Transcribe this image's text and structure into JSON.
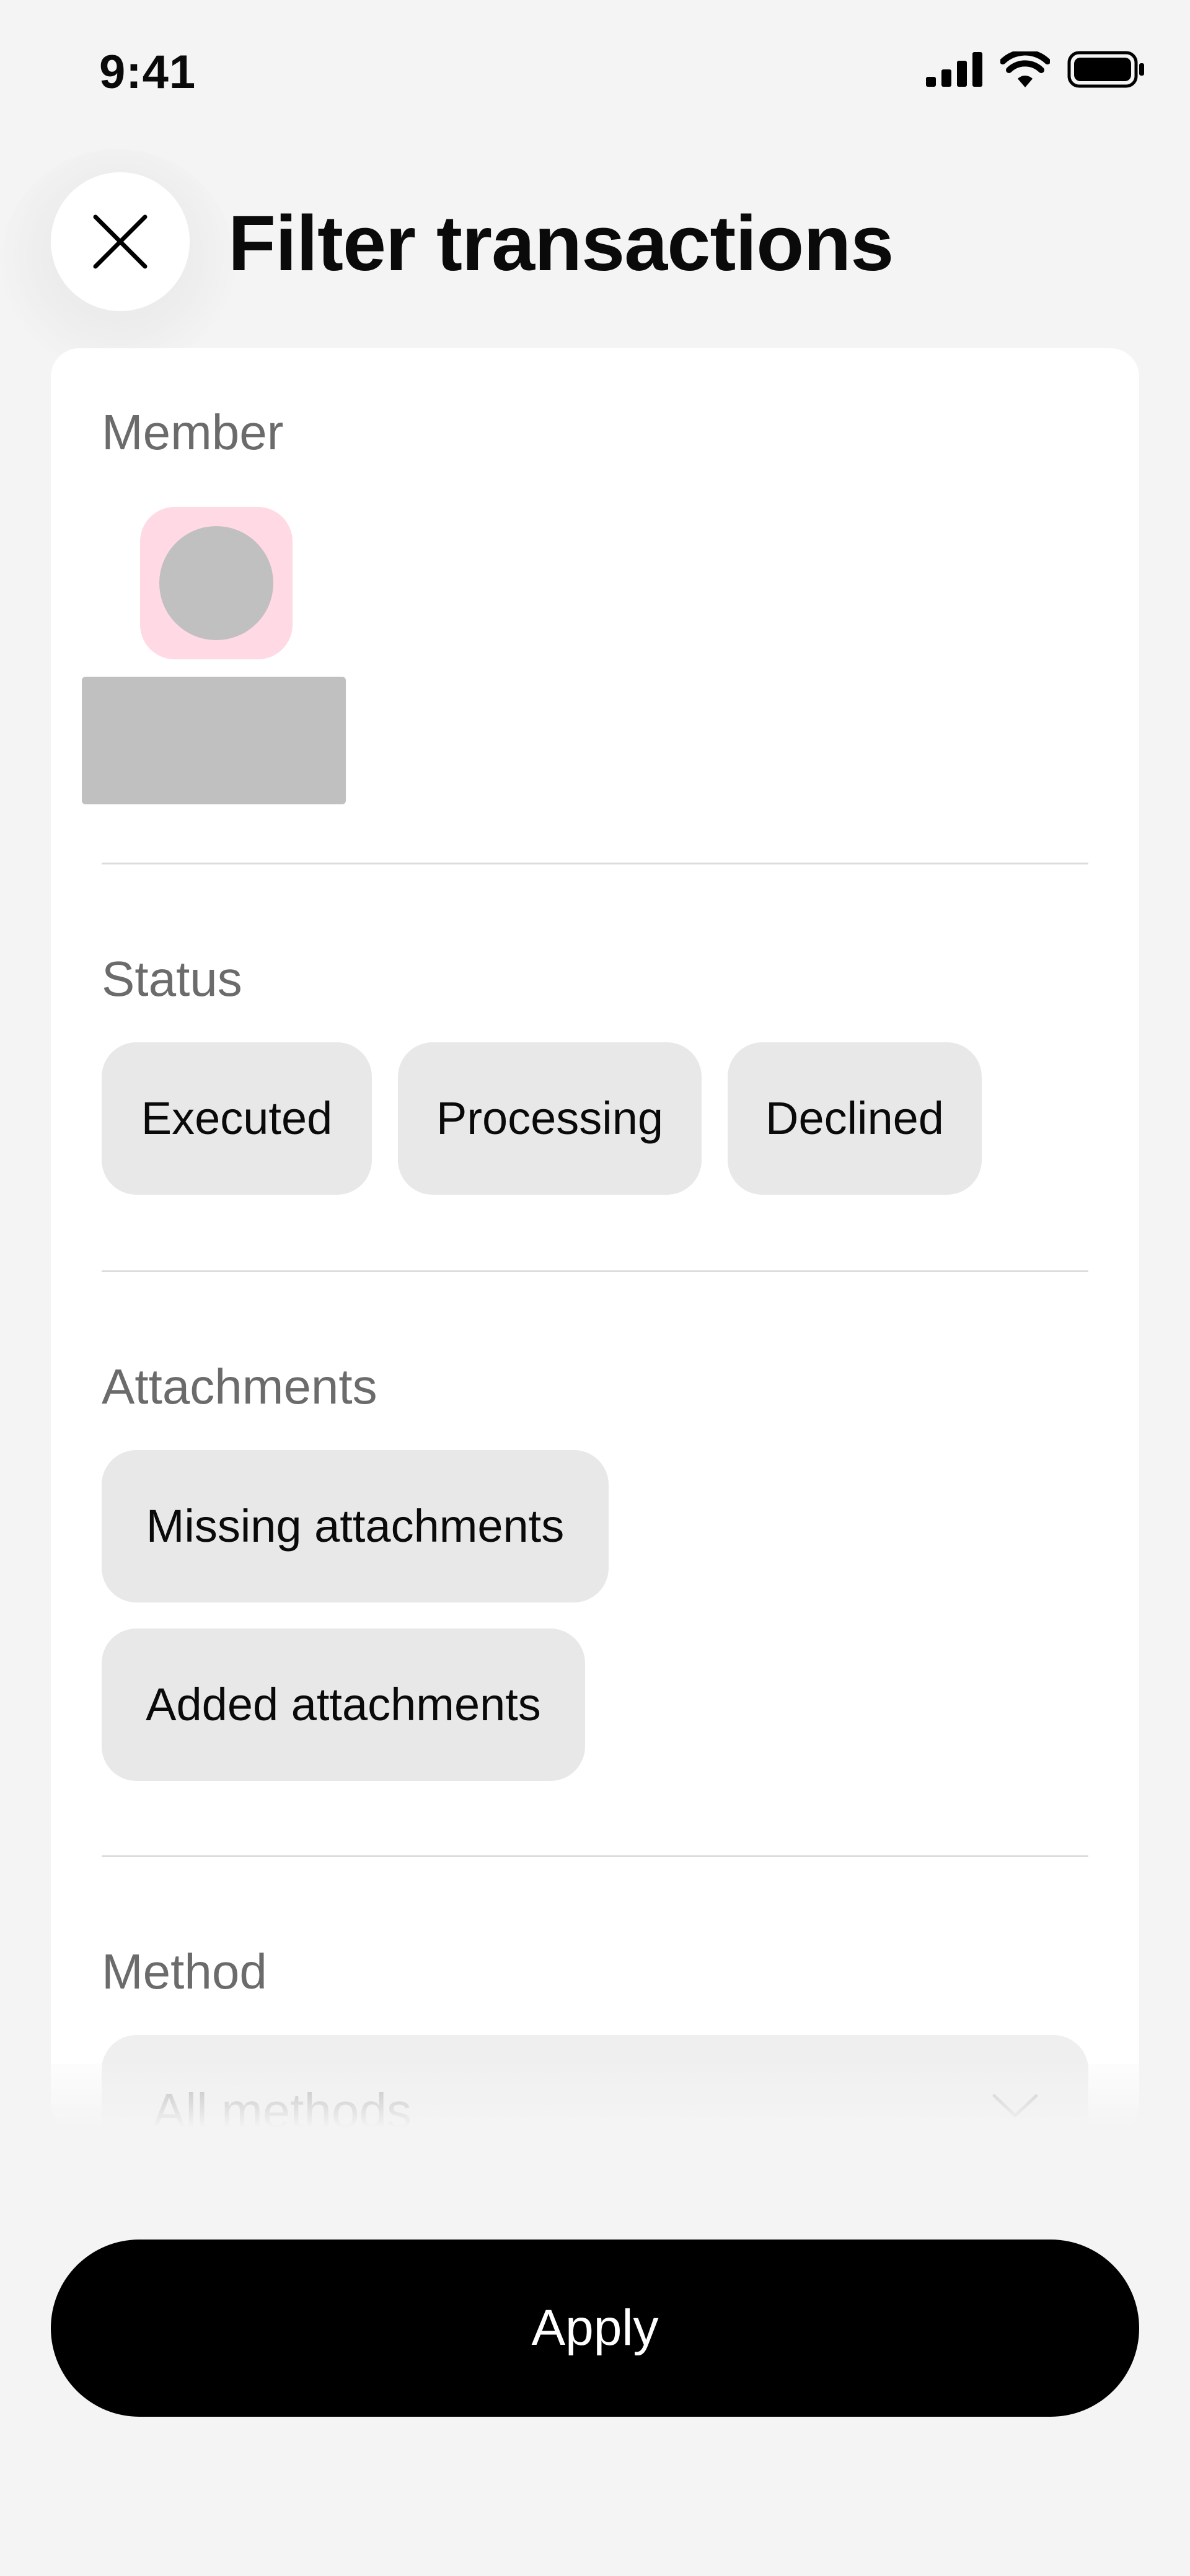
{
  "status_bar": {
    "time": "9:41",
    "icons": [
      "signal-icon",
      "wifi-icon",
      "battery-icon"
    ]
  },
  "header": {
    "close_icon": "close-icon",
    "title": "Filter transactions"
  },
  "sections": {
    "member": {
      "label": "Member"
    },
    "status": {
      "label": "Status",
      "options": [
        "Executed",
        "Processing",
        "Declined"
      ]
    },
    "attachments": {
      "label": "Attachments",
      "options": [
        "Missing attachments",
        "Added attachments"
      ]
    },
    "method": {
      "label": "Method",
      "selected": "All methods",
      "chevron_icon": "chevron-down-icon"
    }
  },
  "footer": {
    "apply_label": "Apply"
  },
  "colors": {
    "background": "#f4f4f4",
    "card": "#ffffff",
    "chip": "#e8e8e8",
    "avatar_bg": "#ffd9e4",
    "button": "#000000"
  }
}
